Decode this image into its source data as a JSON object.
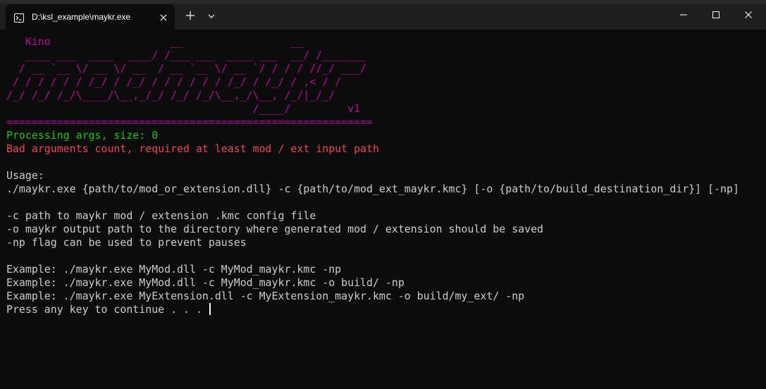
{
  "window": {
    "tab_title": "D:\\ksl_example\\maykr.exe"
  },
  "colors": {
    "background": "#0c0c0c",
    "titlebar": "#1f1f1f",
    "text": "#cccccc",
    "magenta": "#b70aa0",
    "green": "#16c60c",
    "red": "#e74856"
  },
  "terminal": {
    "banner": [
      "   Kino                   __                 __",
      "   ____ ___  ____  ____/ /___ ___  ____ ___  __/ /_______",
      "  / __ `__ \\/ __ \\/ __  / __ `__ \\/ __ `/ / / / //_/ ___/",
      " / / / / / / /_/ / /_/ / / / / / / /_/ / /_/ / ,< / /",
      "/_/ /_/ /_/\\____/\\__,_/_/ /_/ /_/\\__,_/\\__, /_/|_/_/",
      "                                       /____/         v1",
      "=========================================================="
    ],
    "status_line": "Processing args, size: 0",
    "error_line": "Bad arguments count, required at least mod / ext input path",
    "usage_title": "Usage:",
    "usage_command": "./maykr.exe {path/to/mod_or_extension.dll} -c {path/to/mod_ext_maykr.kmc} [-o {path/to/build_destination_dir}] [-np]",
    "options": [
      "-c path to maykr mod / extension .kmc config file",
      "-o maykr output path to the directory where generated mod / extension should be saved",
      "-np flag can be used to prevent pauses"
    ],
    "examples": [
      "Example: ./maykr.exe MyMod.dll -c MyMod_maykr.kmc -np",
      "Example: ./maykr.exe MyMod.dll -c MyMod_maykr.kmc -o build/ -np",
      "Example: ./maykr.exe MyExtension.dll -c MyExtension_maykr.kmc -o build/my_ext/ -np"
    ],
    "prompt": "Press any key to continue . . . "
  }
}
